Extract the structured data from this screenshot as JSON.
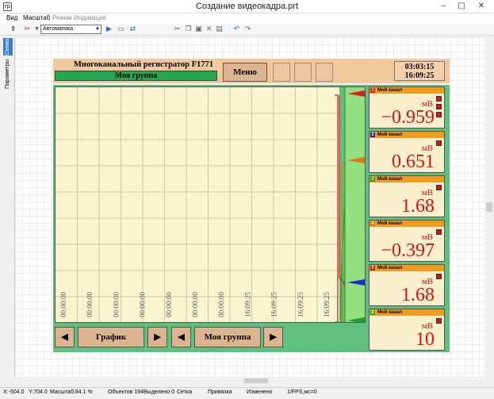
{
  "window": {
    "title": "Создание видеокадра.prt"
  },
  "menu": [
    "Вид",
    "Масштаб",
    "Режим",
    "Индикация"
  ],
  "toolbar": {
    "mode_select": "Автоматика"
  },
  "side_tabs": [
    "Схема",
    "Параметры"
  ],
  "device": {
    "title": "Многоканальный регистратор F1771",
    "group": "Моя группа",
    "menu_button": "Меню",
    "clock_time": "03:03:15",
    "clock_time2": "16:09:25"
  },
  "chart_data": {
    "type": "line",
    "x_tick_labels": [
      "00:00:00",
      "00:00:00",
      "00:00:00",
      "00:00:00",
      "00:00:00",
      "00:00:00",
      "00:00:00",
      "16:09:25",
      "16:09:25",
      "16:09:25",
      "16:09:25"
    ],
    "series_colors": [
      "#d82020",
      "#1c2cc8",
      "#20a020",
      "#e07a10",
      "#c02020",
      "#20a020"
    ]
  },
  "nav": {
    "graph": "График",
    "group": "Моя группа"
  },
  "channels": [
    {
      "num": "1",
      "name": "Мой канал",
      "unit": "мВ",
      "value": "−0.959",
      "color": "#d82020"
    },
    {
      "num": "2",
      "name": "Мой канал",
      "unit": "мВ",
      "value": "0.651",
      "color": "#1c2cc8"
    },
    {
      "num": "3",
      "name": "Мой канал",
      "unit": "мВ",
      "value": "1.68",
      "color": "#20a020"
    },
    {
      "num": "4",
      "name": "Мой канал",
      "unit": "мВ",
      "value": "−0.397",
      "color": "#e07a10"
    },
    {
      "num": "5",
      "name": "Мой канал",
      "unit": "мВ",
      "value": "1.68",
      "color": "#c02020"
    },
    {
      "num": "6",
      "name": "Мой канал",
      "unit": "мВ",
      "value": "10",
      "color": "#20c020"
    }
  ],
  "status": {
    "x": "X:-504.0",
    "y": "Y:704.0",
    "scale": "Масштаб:84.1 %",
    "objects": "Объектов 194",
    "selected": "Выделено 0",
    "grid": "Сетка",
    "snap": "Привязка",
    "changed": "Изменено",
    "fps": "1/FPS,мс=0"
  }
}
